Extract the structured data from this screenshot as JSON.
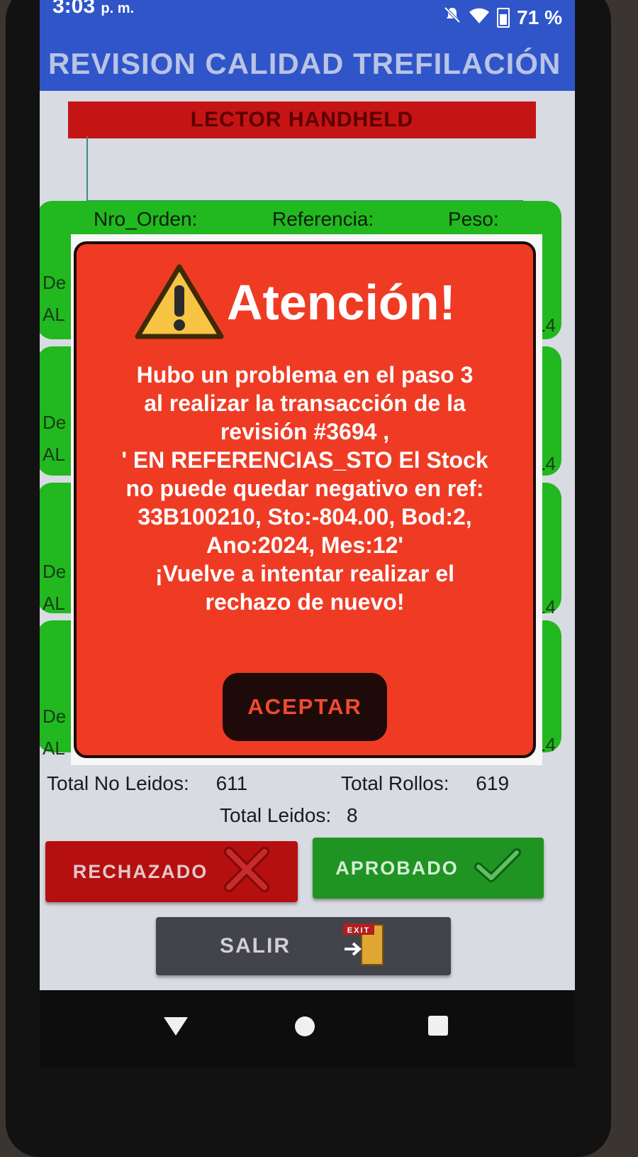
{
  "status_bar": {
    "time": "3:03",
    "time_suffix": "p. m.",
    "battery": "71 %",
    "icons": [
      "mute-icon",
      "wifi-icon",
      "battery-icon"
    ]
  },
  "app": {
    "title": "REVISION CALIDAD TREFILACIÓN"
  },
  "lector": {
    "label": "LECTOR HANDHELD",
    "input_value": ""
  },
  "list": {
    "headers": [
      "Nro_Orden:",
      "Referencia:",
      "Peso:"
    ],
    "cards": [
      {
        "side_label": "De",
        "side_value": "AL",
        "trailing": "14"
      },
      {
        "side_label": "De",
        "side_value": "AL",
        "trailing": "14"
      },
      {
        "side_label": "De",
        "side_value": "AL",
        "trailing": "14"
      },
      {
        "side_label": "De",
        "side_value": "AL",
        "trailing": "14"
      }
    ]
  },
  "totals": {
    "no_leidos_label": "Total No Leidos:",
    "no_leidos_value": "611",
    "rollos_label": "Total Rollos:",
    "rollos_value": "619",
    "leidos_label": "Total Leidos:",
    "leidos_value": "8"
  },
  "buttons": {
    "rechazado": "RECHAZADO",
    "aprobado": "APROBADO",
    "salir": "SALIR",
    "exit_sign": "EXIT"
  },
  "dialog": {
    "title": "Atención!",
    "message_lines": [
      "Hubo un problema en el paso 3",
      "al realizar la transacción de la",
      "revisión #3694 ,",
      "' EN REFERENCIAS_STO El Stock",
      "no puede quedar negativo en ref:",
      "33B100210, Sto:-804.00, Bod:2,",
      "Ano:2024, Mes:12'",
      "¡Vuelve a intentar realizar el",
      "rechazo de nuevo!"
    ],
    "accept_label": "ACEPTAR"
  },
  "colors": {
    "app_bar": "#2f55c9",
    "lector_bar": "#c41414",
    "card_green": "#22b81f",
    "dialog_bg": "#ef3b24",
    "reject": "#b50f10",
    "approve": "#1f9423",
    "exit": "#43434a"
  }
}
